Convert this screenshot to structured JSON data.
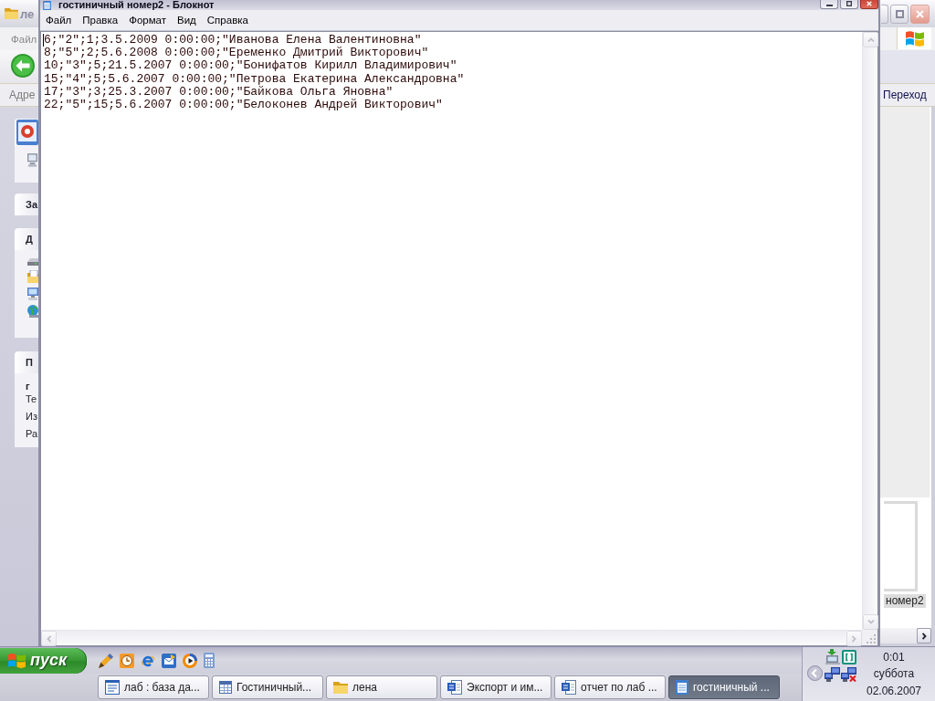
{
  "explorer": {
    "title": "ле",
    "menu": [
      "Файл"
    ],
    "address_label": "Адре",
    "go_button": "Переход",
    "task_pane": [
      {
        "kind": "preview"
      },
      {
        "kind": "tasks",
        "title": "За"
      },
      {
        "kind": "places",
        "title": "Д"
      },
      {
        "kind": "details",
        "title": "П",
        "name": "г",
        "lines": [
          "Те",
          "Из",
          "Ра"
        ]
      }
    ],
    "files": [
      {
        "label": "номер2",
        "selected": true
      }
    ]
  },
  "notepad": {
    "title": "гостиничный номер2 - Блокнот",
    "menu": [
      "Файл",
      "Правка",
      "Формат",
      "Вид",
      "Справка"
    ],
    "lines": [
      "6;\"2\";1;3.5.2009 0:00:00;\"Иванова Елена Валентиновна\"",
      "8;\"5\";2;5.6.2008 0:00:00;\"Еременко Дмитрий Викторович\"",
      "10;\"3\";5;21.5.2007 0:00:00;\"Бонифатов Кирилл Владимирович\"",
      "15;\"4\";5;5.6.2007 0:00:00;\"Петрова Екатерина Александровна\"",
      "17;\"3\";3;25.3.2007 0:00:00;\"Байкова Ольга Яновна\"",
      "22;\"5\";15;5.6.2007 0:00:00;\"Белоконев Андрей Викторович\""
    ]
  },
  "taskbar": {
    "start_button": "пуск",
    "tasks": [
      {
        "label": "лаб : база да...",
        "kind": "database",
        "selected": false
      },
      {
        "label": "Гостиничный...",
        "kind": "table",
        "selected": false
      },
      {
        "label": "лена",
        "kind": "folder",
        "selected": false
      },
      {
        "label": "Экспорт и им...",
        "kind": "word",
        "selected": false
      },
      {
        "label": "отчет по лаб ...",
        "kind": "word",
        "selected": false
      },
      {
        "label": "гостиничный ...",
        "kind": "notepad",
        "selected": true
      }
    ],
    "clock": {
      "time": "0:01",
      "day": "суббота",
      "date": "02.06.2007"
    }
  }
}
